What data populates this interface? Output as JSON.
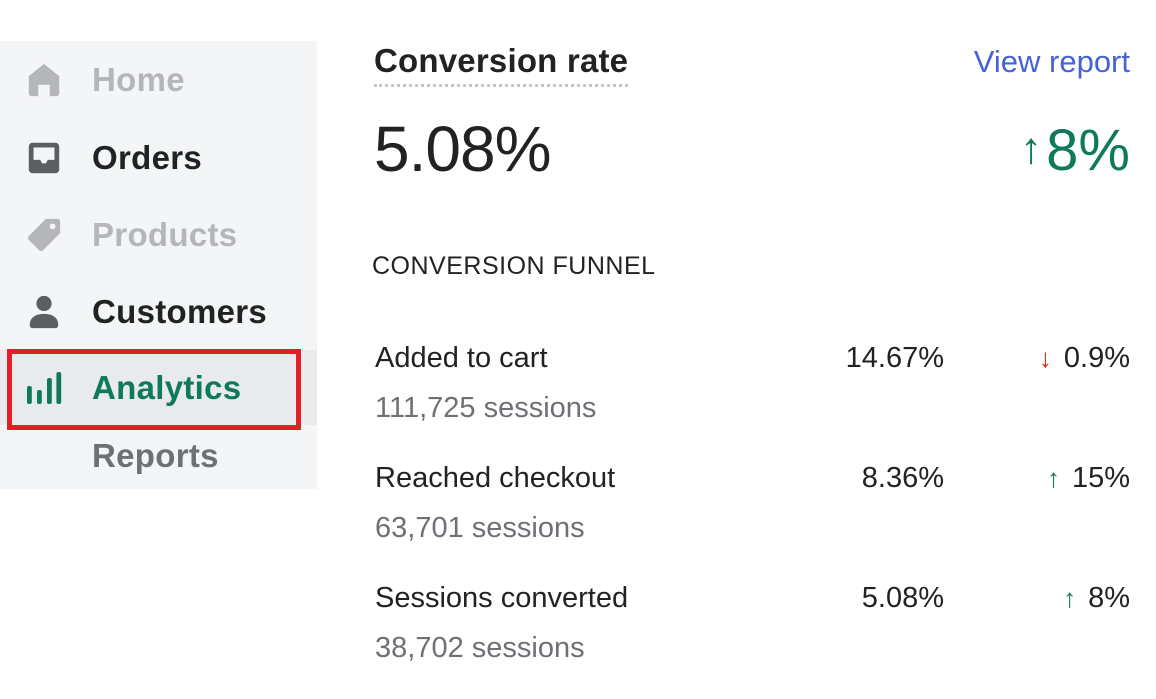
{
  "sidebar": {
    "items": [
      {
        "label": "Home",
        "icon": "home-icon",
        "state": "muted"
      },
      {
        "label": "Orders",
        "icon": "inbox-icon",
        "state": "normal"
      },
      {
        "label": "Products",
        "icon": "tag-icon",
        "state": "muted"
      },
      {
        "label": "Customers",
        "icon": "person-icon",
        "state": "normal"
      },
      {
        "label": "Analytics",
        "icon": "bar-chart-icon",
        "state": "selected"
      },
      {
        "label": "Reports",
        "icon": "",
        "state": "sub-item"
      }
    ],
    "highlight_color": "#e01f26"
  },
  "card": {
    "title": "Conversion rate",
    "view_report_label": "View report",
    "value": "5.08%",
    "change": {
      "direction": "up",
      "arrow": "↑",
      "value": "8%"
    }
  },
  "funnel": {
    "title": "CONVERSION FUNNEL",
    "rows": [
      {
        "name": "Added to cart",
        "sessions": "111,725 sessions",
        "rate": "14.67%",
        "change": {
          "direction": "down",
          "arrow": "↓",
          "value": "0.9%"
        }
      },
      {
        "name": "Reached checkout",
        "sessions": "63,701 sessions",
        "rate": "8.36%",
        "change": {
          "direction": "up",
          "arrow": "↑",
          "value": "15%"
        }
      },
      {
        "name": "Sessions converted",
        "sessions": "38,702 sessions",
        "rate": "5.08%",
        "change": {
          "direction": "up",
          "arrow": "↑",
          "value": "8%"
        }
      }
    ]
  },
  "colors": {
    "positive": "#0f7a5a",
    "negative": "#d72c0d",
    "link": "#4662d5"
  }
}
